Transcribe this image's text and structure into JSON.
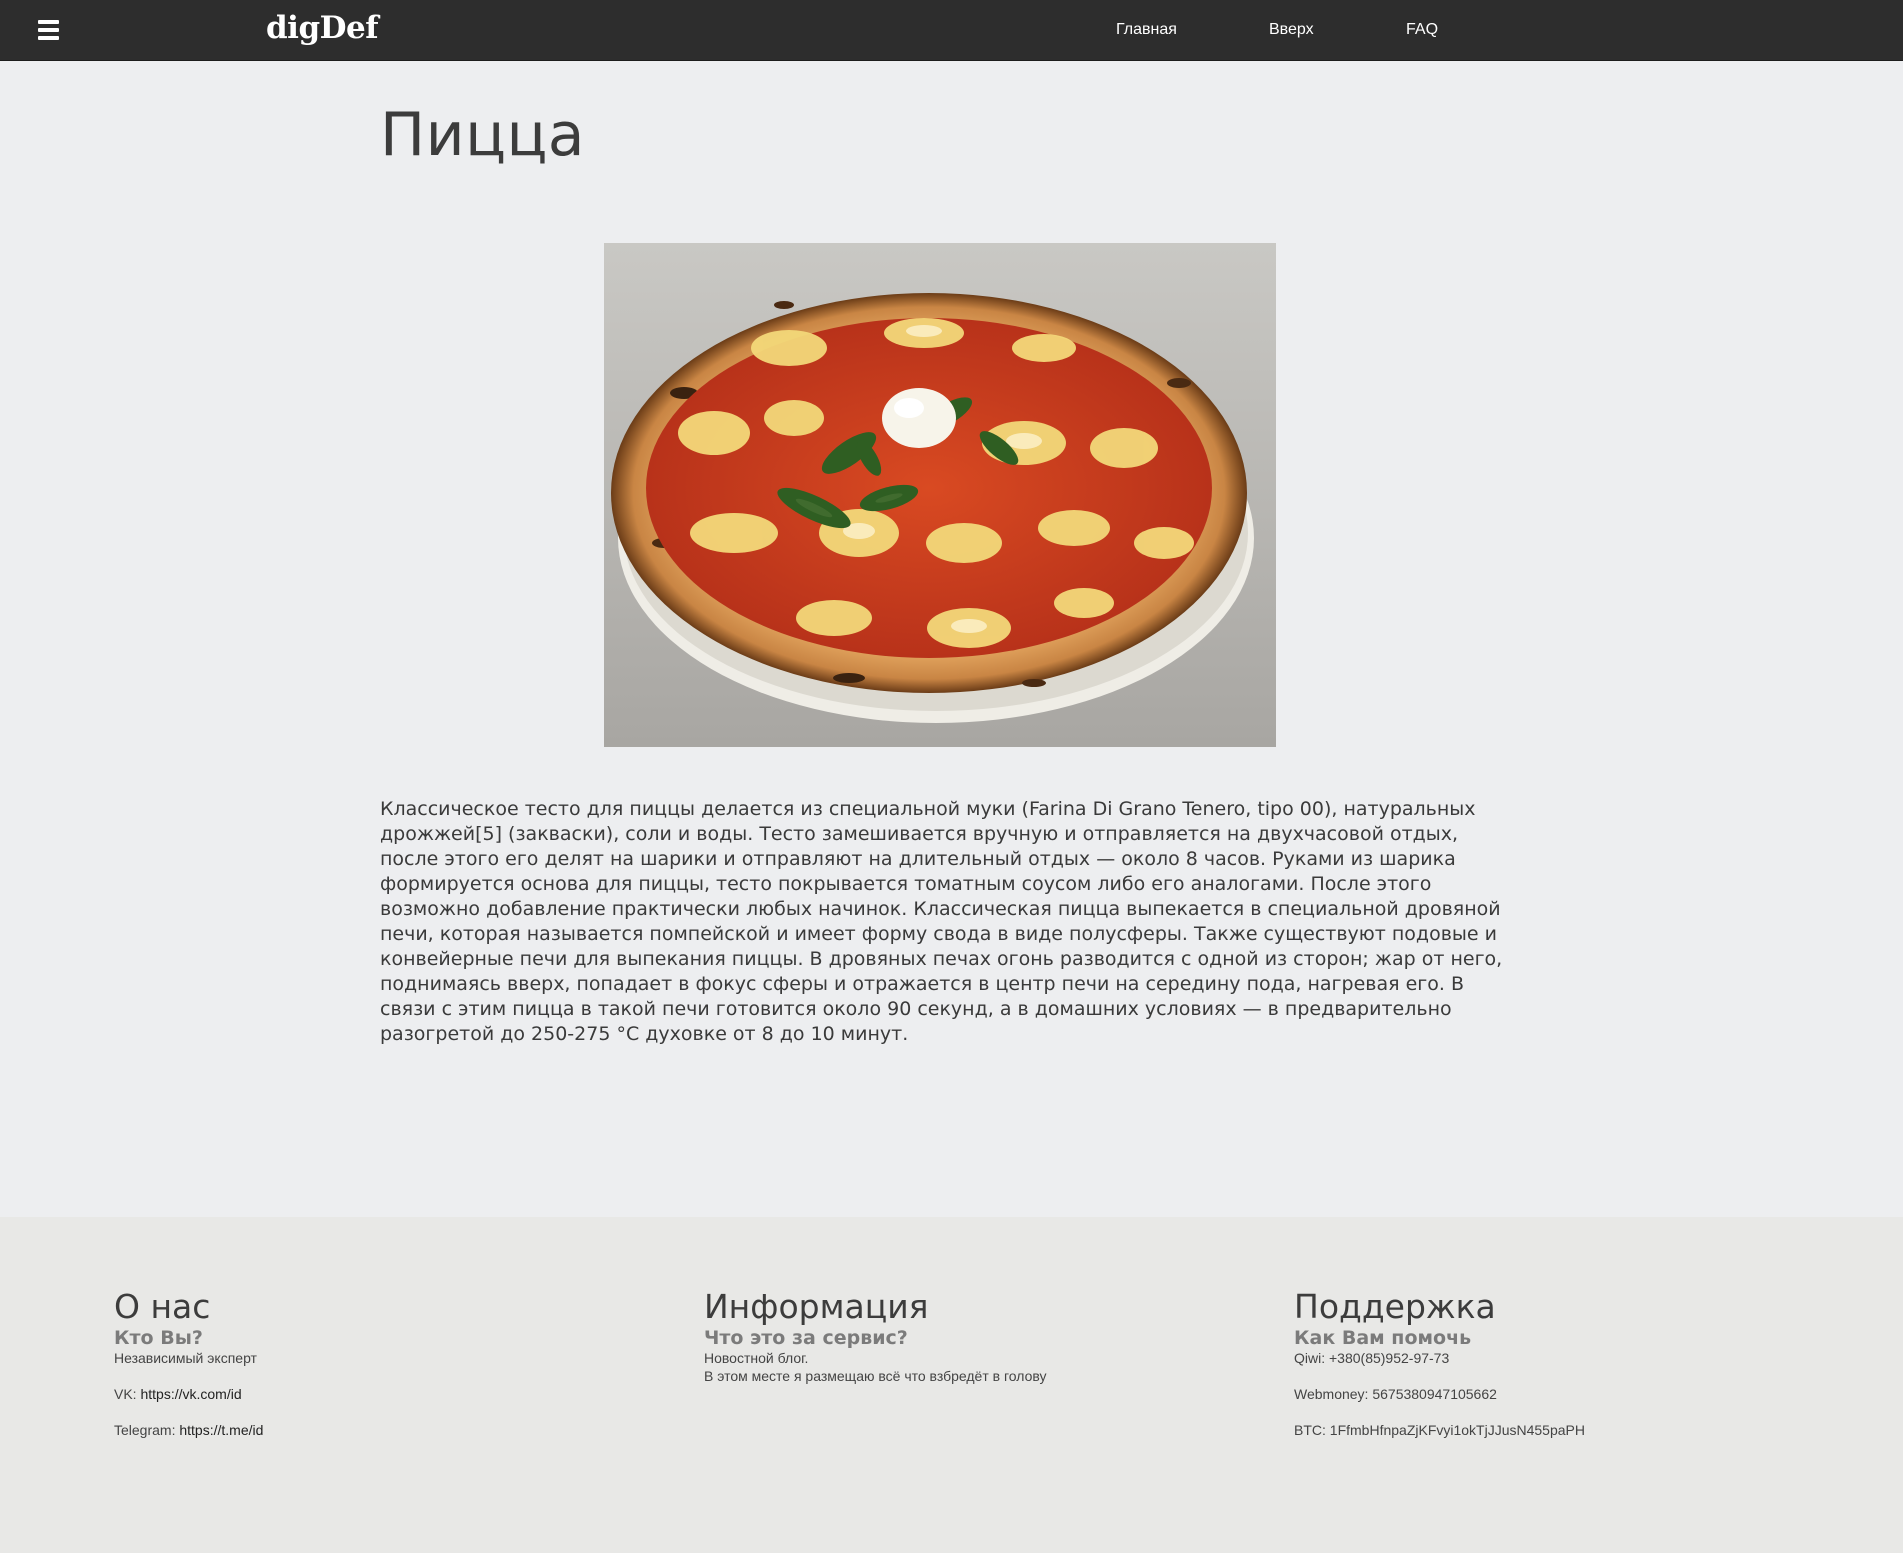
{
  "navbar": {
    "logo": "digDef",
    "links": [
      {
        "label": "Главная"
      },
      {
        "label": "Вверх"
      },
      {
        "label": "FAQ"
      }
    ],
    "menu_icon": "hamburger-menu-icon"
  },
  "article": {
    "title": "Пицца",
    "image_subject": "pizza margherita photo",
    "body": "Классическое тесто для пиццы делается из специальной муки (Farina Di Grano Tenero, tipo 00), натуральных дрожжей[5] (закваски), соли и воды. Тесто замешивается вручную и отправляется на двухчасовой отдых, после этого его делят на шарики и отправляют на длительный отдых — около 8 часов. Руками из шарика формируется основа для пиццы, тесто покрывается томатным соусом либо его аналогами. После этого возможно добавление практически любых начинок. Классическая пицца выпекается в специальной дровяной печи, которая называется помпейской и имеет форму свода в виде полусферы. Также существуют подовые и конвейерные печи для выпекания пиццы. В дровяных печах огонь разводится с одной из сторон; жар от него, поднимаясь вверх, попадает в фокус сферы и отражается в центр печи на середину пода, нагревая его. В связи с этим пицца в такой печи готовится около 90 секунд, а в домашних условиях — в предварительно разогретой до 250-275 °C духовке от 8 до 10 минут."
  },
  "footer": {
    "about": {
      "heading": "О нас",
      "subheading": "Кто Вы?",
      "description": "Независимый эксперт",
      "vk_label": "VK: ",
      "vk_link": "https://vk.com/id",
      "telegram_label": "Telegram: ",
      "telegram_link": "https://t.me/id"
    },
    "info": {
      "heading": "Информация",
      "subheading": "Что это за сервис?",
      "line1": "Новостной блог.",
      "line2": "В этом месте я размещаю всё что взбредёт в голову"
    },
    "support": {
      "heading": "Поддержка",
      "subheading": "Как Вам помочь",
      "qiwi": "Qiwi: +380(85)952-97-73",
      "webmoney": "Webmoney: 5675380947105662",
      "btc": "BTC: 1FfmbHfnpaZjKFvyi1okTjJJusN455paPH"
    }
  },
  "colors": {
    "navbar_bg": "#2d2d2d",
    "page_bg": "#edeef0",
    "footer_bg": "#e8e8e6",
    "heading_text": "#3c3c3c",
    "subheading_text": "#7b7b7b"
  }
}
